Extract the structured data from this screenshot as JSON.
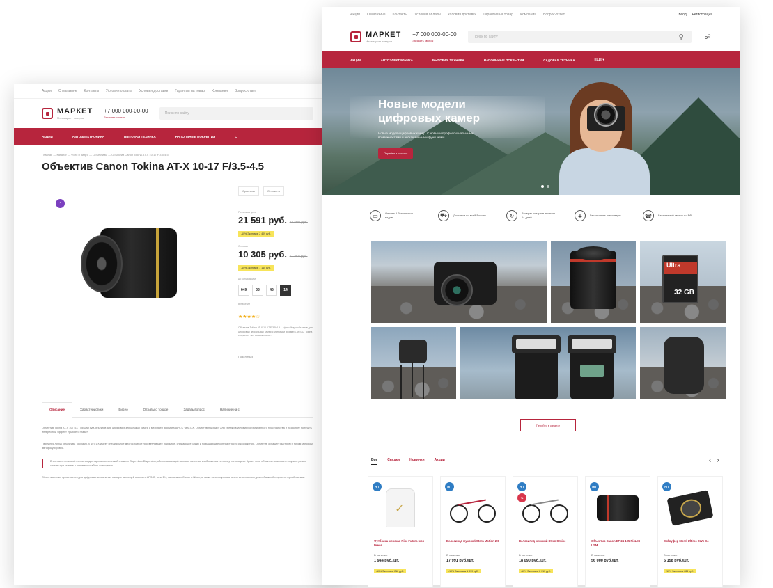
{
  "left_window": {
    "topnav": [
      "Акции",
      "О магазине",
      "Контакты",
      "Условия оплаты",
      "Условия доставки",
      "Гарантия на товар",
      "Компания",
      "Вопрос-ответ"
    ],
    "logo": {
      "name": "МАРКЕТ",
      "sub": "Мегамаркет товаров"
    },
    "phone": {
      "number": "+7 000 000-00-00",
      "callback": "Заказать звонок"
    },
    "search_placeholder": "Поиск по сайту",
    "menu": [
      "Акции",
      "Автоэлектроника",
      "Бытовая техника",
      "Напольные покрытия",
      "С"
    ],
    "breadcrumbs": "Главная — Каталог — Фото и видео — Объективы — Объектив Canon Tokina AT-X 10-17 F/3.5-4.5",
    "title": "Объектив Canon Tokina AT-X 10-17 F/3.5-4.5",
    "tools": {
      "compare": "Сравнить",
      "favorite": "Отложить"
    },
    "price1": {
      "label": "Розничная цена",
      "value": "21 591 руб.",
      "old": "24 000 руб.",
      "saving": "-10%   Экономия 2 409 руб."
    },
    "price2": {
      "label": "Оптовая",
      "value": "10 305 руб.",
      "old": "11 450 руб.",
      "saving": "-10%   Экономия 1 145 руб."
    },
    "timer_label": "До конца акции",
    "timer": [
      "649",
      "03",
      "46",
      "14"
    ],
    "stock": "В наличии",
    "stars": "★★★★☆",
    "description": "Объектив Tokina AT-X 10-17 F/3.5-4.5 — фишай зум-объектив для цифровых зеркальных камер с матрицей формата APS-C. Tokina сохраняет все возможности...",
    "share": "Поделиться",
    "tabs": [
      "Описание",
      "Характеристики",
      "Видео",
      "Отзывы о товаре",
      "Задать вопрос",
      "Наличие на с"
    ],
    "text_p1": "Объектив Tokina AT-X 107 DX - фишай зум-объектив для цифровых зеркальных камер с матрицей формата APS-C типа DX. Объектив подходит для съемки в условиях ограниченного пространства и позволяет получить интересный эффект «рыбьего глаза».",
    "text_p2": "Передняя линза объектива Tokina AT-X 107 DX имеет специальное многослойное просветляющее покрытие, снижающее блики и повышающее контрастность изображения. Объектив оснащен быстрым и тихим мотором автофокусировки.",
    "text_quote": "В состав оптической схемы входят один асферический элемент Super-Low Dispersion, обеспечивающий высокое качество изображения по всему полю кадра. Кроме того, объектив позволяет получать резкие снимки при съемке в условиях слабого освещения.",
    "text_p3": "Объектив легко применяется для цифровых зеркальных камер с матрицей формата APS-C, типа DX, на съемках Canon и Nikon, а также используется в качестве основного для пейзажной и архитектурной съемки."
  },
  "right_window": {
    "topnav": [
      "Акции",
      "О магазине",
      "Контакты",
      "Условия оплаты",
      "Условия доставки",
      "Гарантия на товар",
      "Компания",
      "Вопрос-ответ"
    ],
    "topnav_right": [
      "Вход",
      "Регистрация"
    ],
    "logo": {
      "name": "МАРКЕТ",
      "sub": "Мегамаркет товаров"
    },
    "phone": {
      "number": "+7 000 000-00-00",
      "callback": "Заказать звонок"
    },
    "search_placeholder": "Поиск по сайту",
    "menu": [
      "Акции",
      "Автоэлектроника",
      "Бытовая техника",
      "Напольные покрытия",
      "Садовая техника",
      "Ещё ▾"
    ],
    "hero": {
      "title": "Новые модели цифровых камер",
      "desc": "Новые модели цифровых камер. С новыми профессиональными возможностями и эксклюзивными функциями.",
      "button": "Перейти в каталог"
    },
    "features": [
      {
        "icon": "▭",
        "text": "Оплата 5 безопасных видов"
      },
      {
        "icon": "⛟",
        "text": "Доставка по всей России"
      },
      {
        "icon": "↻",
        "text": "Возврат товара в течение 14 дней"
      },
      {
        "icon": "◈",
        "text": "Гарантия на все товары"
      },
      {
        "icon": "☎",
        "text": "Бесплатный звонок по РФ"
      }
    ],
    "sd_card": {
      "brand": "Ultra",
      "size": "32 GB"
    },
    "more_button": "Перейти в каталог",
    "product_tabs": [
      "Все",
      "Скидки",
      "Новинки",
      "Акции"
    ],
    "products": [
      {
        "badge": "HIT",
        "name": "Футболка женская Nike Futura Icon Dress",
        "stock": "В наличии",
        "price": "1 944 руб./шт.",
        "sale": "-10%   Экономия 216 руб."
      },
      {
        "badge": "HIT",
        "name": "Велосипед мужской Stern Motion 2.0",
        "stock": "В наличии",
        "price": "17 991 руб./шт.",
        "sale": "-10%   Экономия 1 999 руб."
      },
      {
        "badge": "HIT",
        "badge2": "%",
        "name": "Велосипед женский Stern Cruise",
        "stock": "В наличии",
        "price": "18 090 руб./шт.",
        "sale": "-10%   Экономия 2 010 руб."
      },
      {
        "badge": "HIT",
        "name": "Объектив Canon EF 24-105 F/4L IS USM",
        "stock": "В наличии",
        "price": "56 000 руб./шт.",
        "sale": ""
      },
      {
        "badge": "HIT",
        "name": "Сабвуфер Morel Ultimo SW6 D4",
        "stock": "В наличии",
        "price": "6 158 руб./шт.",
        "sale": "-10%   Экономия 684 руб."
      }
    ]
  }
}
